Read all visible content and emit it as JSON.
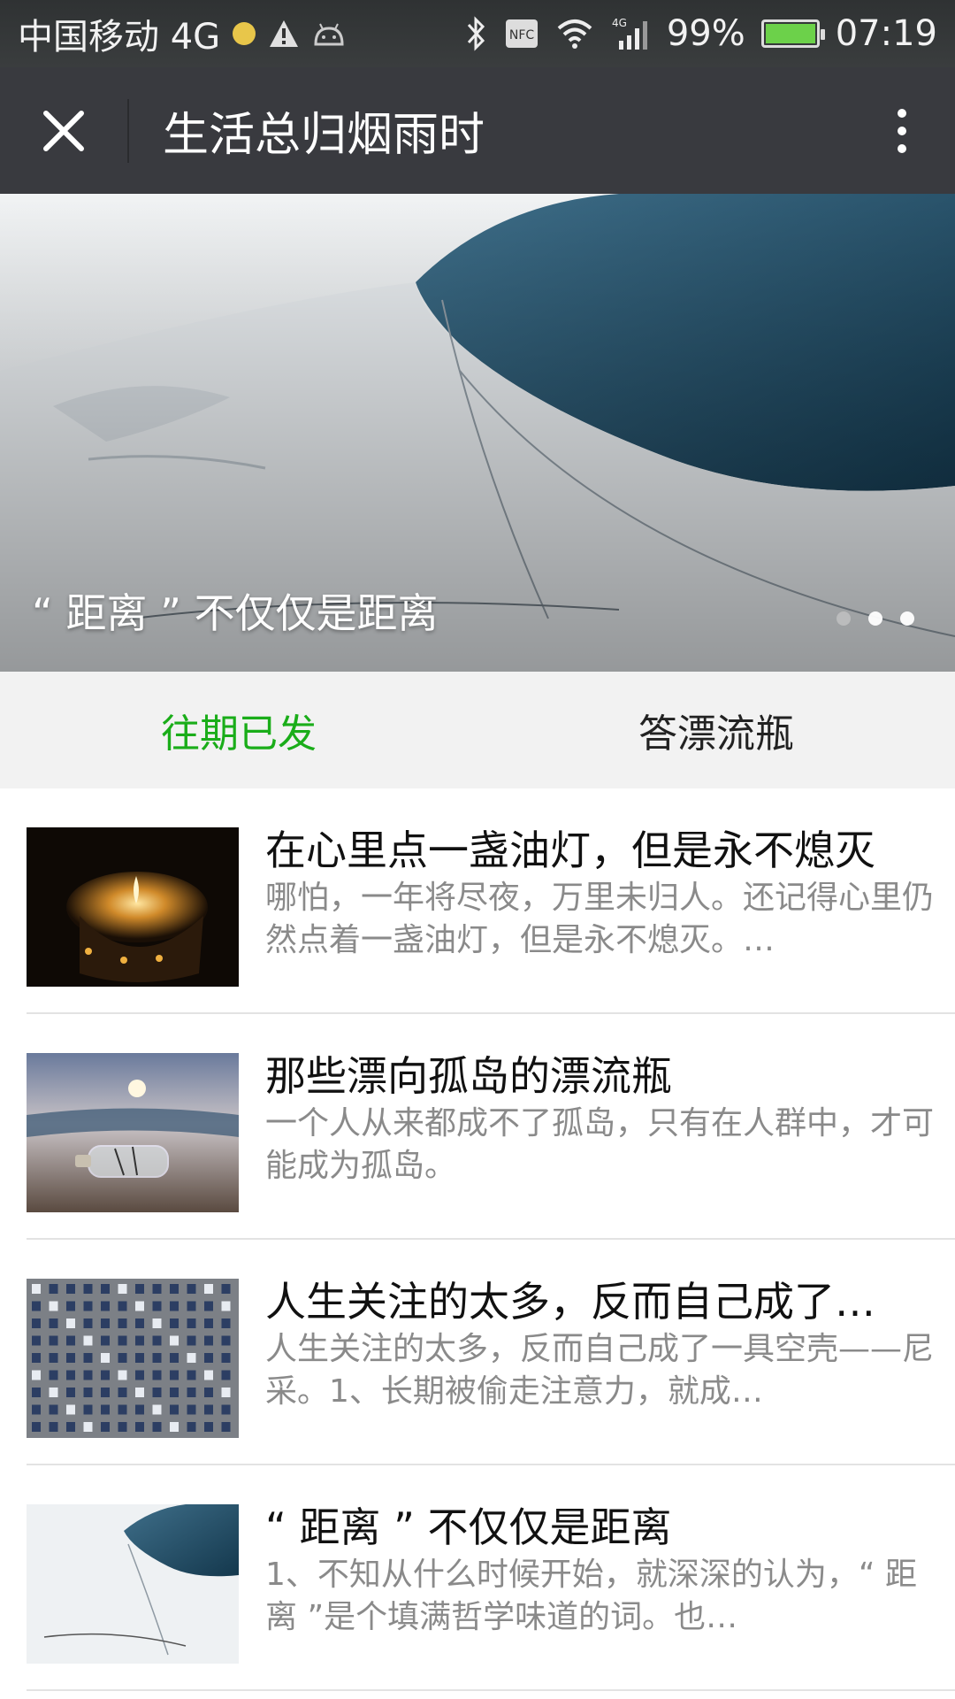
{
  "status_bar": {
    "carrier": "中国移动 4G",
    "battery": "99%",
    "time": "07:19",
    "network_badge": "4G",
    "nfc_label": "NFC",
    "icons": [
      "warning-icon",
      "android-icon",
      "bluetooth-icon",
      "nfc-icon",
      "wifi-icon",
      "signal-icon",
      "battery-icon"
    ]
  },
  "titlebar": {
    "title": "生活总归烟雨时"
  },
  "banner": {
    "caption": "“ 距离 ” 不仅仅是距离",
    "page_count": 3,
    "active_index": 0
  },
  "tabs": [
    {
      "label": "往期已发",
      "active": true
    },
    {
      "label": "答漂流瓶",
      "active": false
    }
  ],
  "articles": [
    {
      "title": " 在心里点一盏油灯，但是永不熄灭",
      "desc": "哪怕，一年将尽夜，万里未归人。还记得心里仍然点着一盏油灯，但是永不熄灭。…",
      "thumb": "candle"
    },
    {
      "title": "那些漂向孤岛的漂流瓶",
      "desc": "一个人从来都成不了孤岛，只有在人群中，才可能成为孤岛。",
      "thumb": "bottle"
    },
    {
      "title": "人生关注的太多，反而自己成了…",
      "desc": "人生关注的太多，反而自己成了一具空壳——尼采。1、长期被偷走注意力，就成…",
      "thumb": "building"
    },
    {
      "title": "“ 距离 ” 不仅仅是距离",
      "desc": "1、不知从什么时候开始，就深深的认为，“ 距离 ”是个填满哲学味道的词。也…",
      "thumb": "snow"
    }
  ],
  "colors": {
    "accent": "#1aad19",
    "titlebar": "#393a3f",
    "statusbar": "#2f3233"
  }
}
